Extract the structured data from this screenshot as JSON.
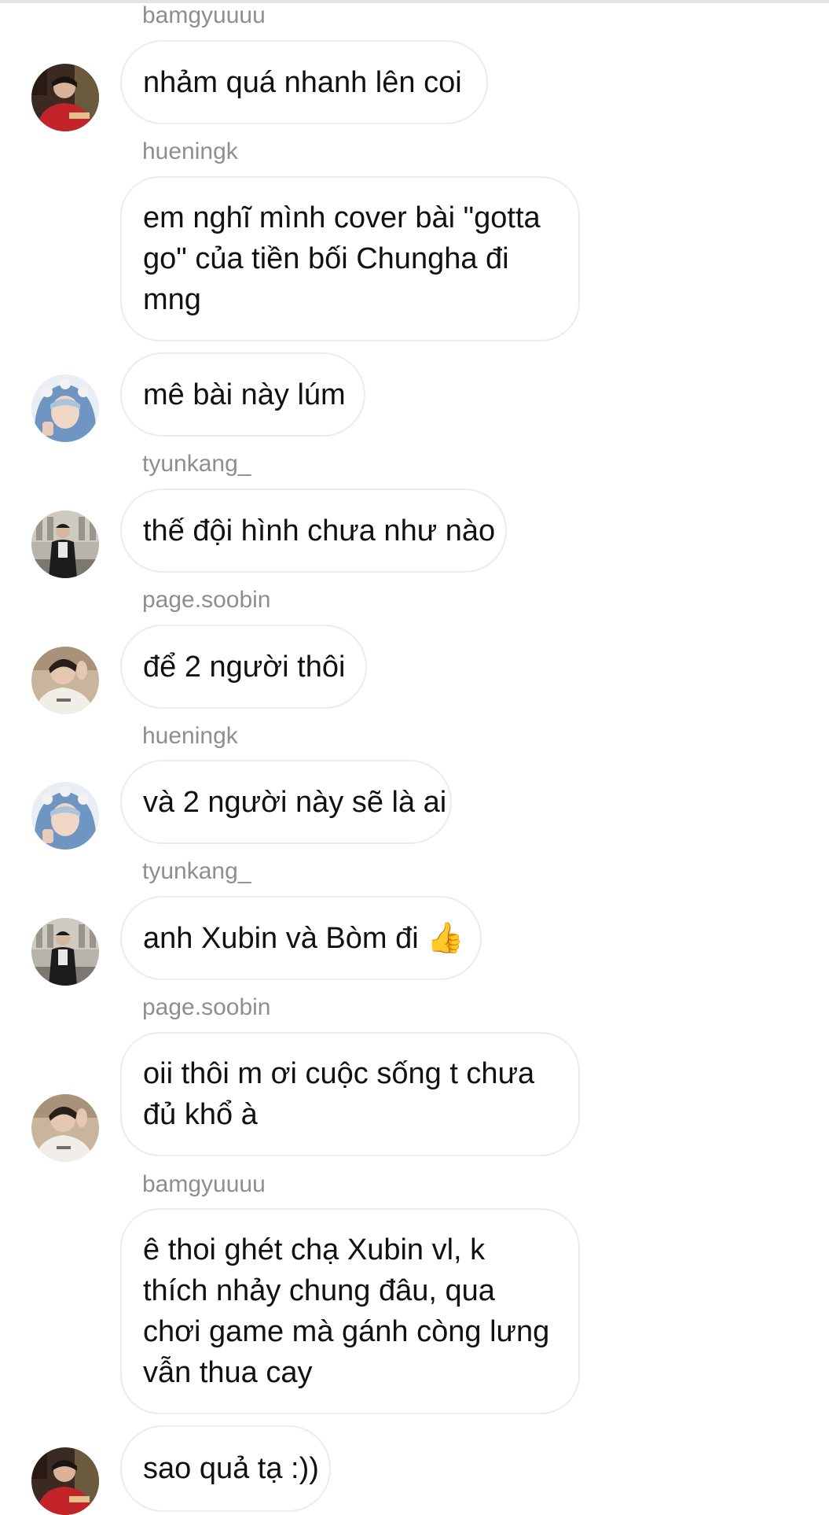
{
  "thread": {
    "messages": [
      {
        "sender": "bamgyuuuu",
        "text": "nhảm quá nhanh lên coi"
      },
      {
        "sender": "hueningk",
        "text": "em nghĩ mình cover bài \"gotta go\" của tiền bối Chungha đi mng"
      },
      {
        "sender": "hueningk",
        "text": "mê bài này lúm"
      },
      {
        "sender": "tyunkang_",
        "text": "thế đội hình chưa như nào"
      },
      {
        "sender": "page.soobin",
        "text": "để 2 người thôi"
      },
      {
        "sender": "hueningk",
        "text": "và 2 người này sẽ là ai"
      },
      {
        "sender": "tyunkang_",
        "text": "anh Xubin và Bòm đi 👍"
      },
      {
        "sender": "page.soobin",
        "text": "oii thôi m ơi cuộc sống t chưa đủ khổ à"
      },
      {
        "sender": "bamgyuuuu",
        "text": "ê thoi ghét chạ Xubin vl, k thích nhảy chung đâu, qua chơi game mà gánh còng lưng vẫn thua cay"
      },
      {
        "sender": "bamgyuuuu",
        "text": "sao quả tạ :))"
      }
    ]
  },
  "colors": {
    "background": "#ffffff",
    "bubble_border": "#ececec",
    "username": "#8e8e8e",
    "text": "#111111"
  },
  "icons": {
    "avatar_bamgyuuuu": "user-avatar-red-shirt",
    "avatar_hueningk": "user-avatar-blue-hood",
    "avatar_tyunkang": "user-avatar-city-street",
    "avatar_soobin": "user-avatar-white-sweater"
  }
}
